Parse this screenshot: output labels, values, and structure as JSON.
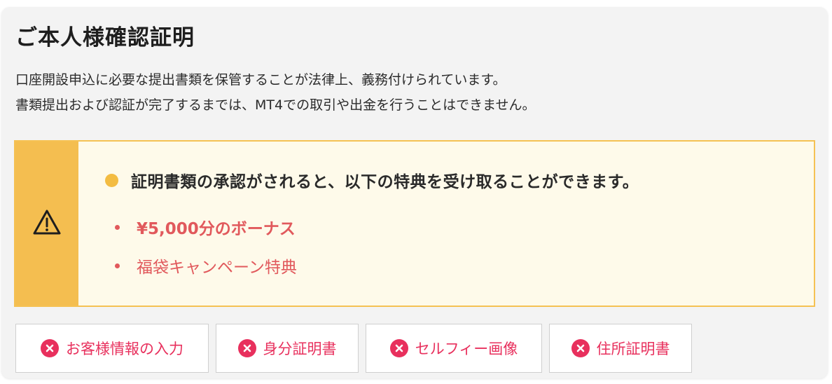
{
  "title": "ご本人様確認証明",
  "description": {
    "line1": "口座開設申込に必要な提出書類を保管することが法律上、義務付けられています。",
    "line2": "書類提出および認証が完了するまでは、MT4での取引や出金を行うことはできません。"
  },
  "notice": {
    "icon": "warning-triangle-icon",
    "heading": "証明書類の承認がされると、以下の特典を受け取ることができます。",
    "benefits": [
      {
        "label": "¥5,000分のボーナス"
      },
      {
        "label": "福袋キャンペーン特典"
      }
    ],
    "colors": {
      "side": "#f4be50",
      "background": "#fefaea",
      "benefit_text": "#e1595c"
    }
  },
  "steps": [
    {
      "label": "お客様情報の入力",
      "status": "incomplete",
      "icon": "x-circle-icon"
    },
    {
      "label": "身分証明書",
      "status": "incomplete",
      "icon": "x-circle-icon"
    },
    {
      "label": "セルフィー画像",
      "status": "incomplete",
      "icon": "x-circle-icon"
    },
    {
      "label": "住所証明書",
      "status": "incomplete",
      "icon": "x-circle-icon"
    }
  ],
  "colors": {
    "status_incomplete": "#e8305d"
  }
}
